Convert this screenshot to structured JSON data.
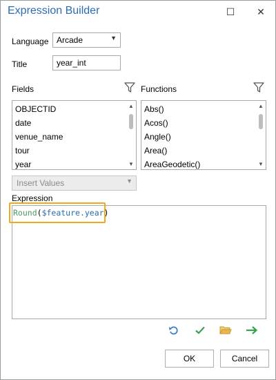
{
  "window": {
    "title": "Expression Builder",
    "maximize_glyph": "☐",
    "close_glyph": "✕"
  },
  "language": {
    "label": "Language",
    "value": "Arcade"
  },
  "title_field": {
    "label": "Title",
    "value": "year_int"
  },
  "fields": {
    "label": "Fields",
    "items": [
      "OBJECTID",
      "date",
      "venue_name",
      "tour",
      "year"
    ]
  },
  "functions": {
    "label": "Functions",
    "items": [
      "Abs()",
      "Acos()",
      "Angle()",
      "Area()",
      "AreaGeodetic()"
    ]
  },
  "insert_values": {
    "label": "Insert Values"
  },
  "expression": {
    "label": "Expression",
    "fn": "Round",
    "open": "(",
    "var": "$feature.year",
    "close": ")"
  },
  "toolbar": {
    "icons": [
      "undo-icon",
      "verify-icon",
      "open-folder-icon",
      "apply-arrow-icon"
    ]
  },
  "buttons": {
    "ok": "OK",
    "cancel": "Cancel"
  },
  "colors": {
    "title": "#2b6cb0",
    "highlight": "#f0a81c",
    "check": "#3aa04c",
    "arrow": "#3aa04c",
    "folder": "#e8b64a",
    "undo": "#3b7fc4"
  }
}
